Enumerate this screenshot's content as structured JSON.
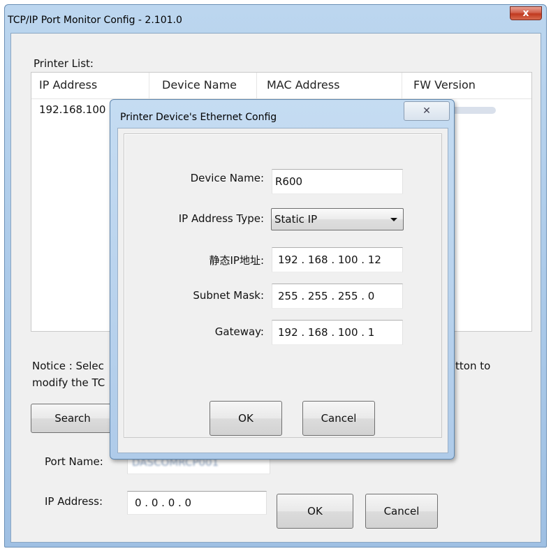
{
  "window": {
    "title": "TCP/IP Port Monitor Config - 2.101.0",
    "close_label": "x"
  },
  "printer_list": {
    "label": "Printer List:",
    "columns": [
      "IP Address",
      "Device Name",
      "MAC Address",
      "FW Version"
    ],
    "rows": [
      {
        "ip": "192.168.100"
      }
    ]
  },
  "notice": {
    "line1_left": "Notice : Selec",
    "line1_right": "tton to",
    "line2_left": "modify the TC"
  },
  "buttons": {
    "search": "Search",
    "ok": "OK",
    "cancel": "Cancel"
  },
  "port": {
    "port_name_label": "Port Name:",
    "port_name_value": "DASCOMRCP001",
    "ip_label": "IP Address:",
    "ip_value": "0 . 0 . 0 . 0"
  },
  "dialog": {
    "title": "Printer Device's Ethernet Config",
    "close_label": "✕",
    "device_name_label": "Device Name:",
    "device_name_value": "R600",
    "ip_type_label": "IP Address Type:",
    "ip_type_value": "Static IP",
    "static_ip_label": "静态IP地址:",
    "static_ip_value": "192 . 168 . 100 . 12",
    "subnet_label": "Subnet Mask:",
    "subnet_value": "255 . 255 . 255 .  0",
    "gateway_label": "Gateway:",
    "gateway_value": "192 . 168 . 100 .  1",
    "ok": "OK",
    "cancel": "Cancel"
  }
}
